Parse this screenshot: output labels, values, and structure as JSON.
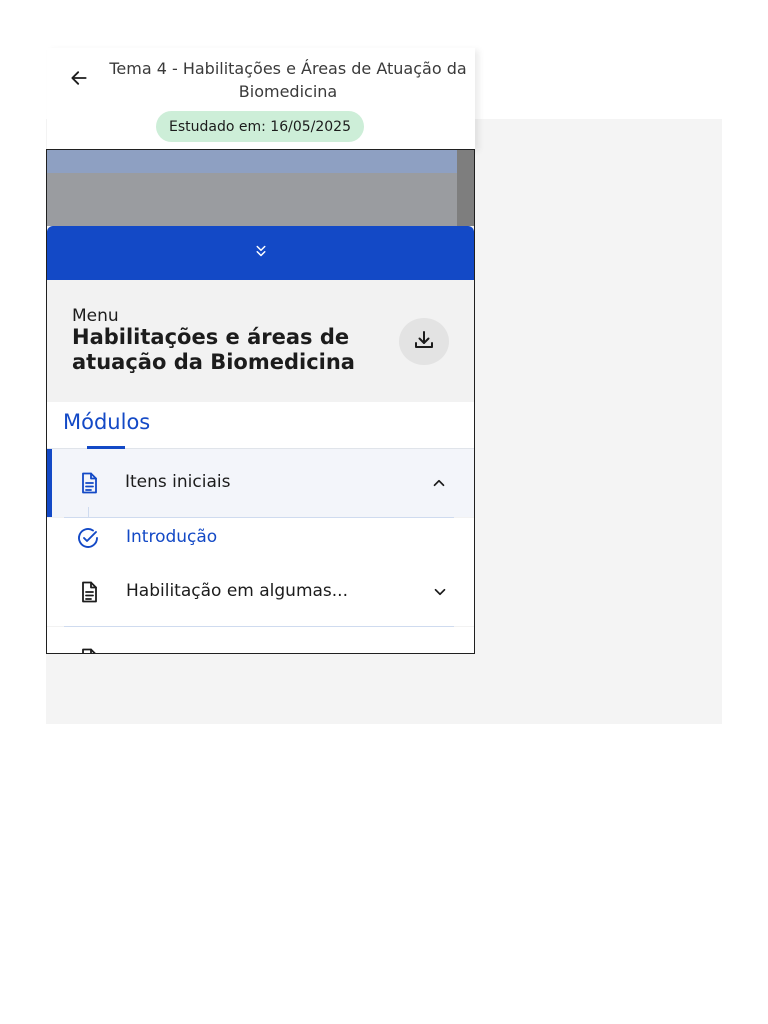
{
  "header": {
    "title": "Tema 4 - Habilitações e Áreas de Atuação da Biomedicina",
    "studied_badge": "Estudado em: 16/05/2025",
    "back_icon": "arrow-left-icon"
  },
  "collapse_bar": {
    "icon": "chevrons-down-icon",
    "color": "#1349c6"
  },
  "menu": {
    "label": "Menu",
    "heading": "Habilitações e áreas de atuação da Biomedicina",
    "download_icon": "download-icon"
  },
  "tabs": {
    "modules_label": "Módulos"
  },
  "modules": [
    {
      "label": "Itens iniciais",
      "icon": "document-icon",
      "expanded": true,
      "subitems": [
        {
          "label": "Introdução",
          "icon": "check-circle-icon",
          "completed": true
        }
      ]
    },
    {
      "label": "Habilitação em algumas...",
      "icon": "document-icon",
      "expanded": false
    },
    {
      "icon": "document-icon"
    }
  ],
  "colors": {
    "accent": "#1349c6",
    "badge_bg": "#cdeed8",
    "panel_bg": "#f2f2f2"
  }
}
